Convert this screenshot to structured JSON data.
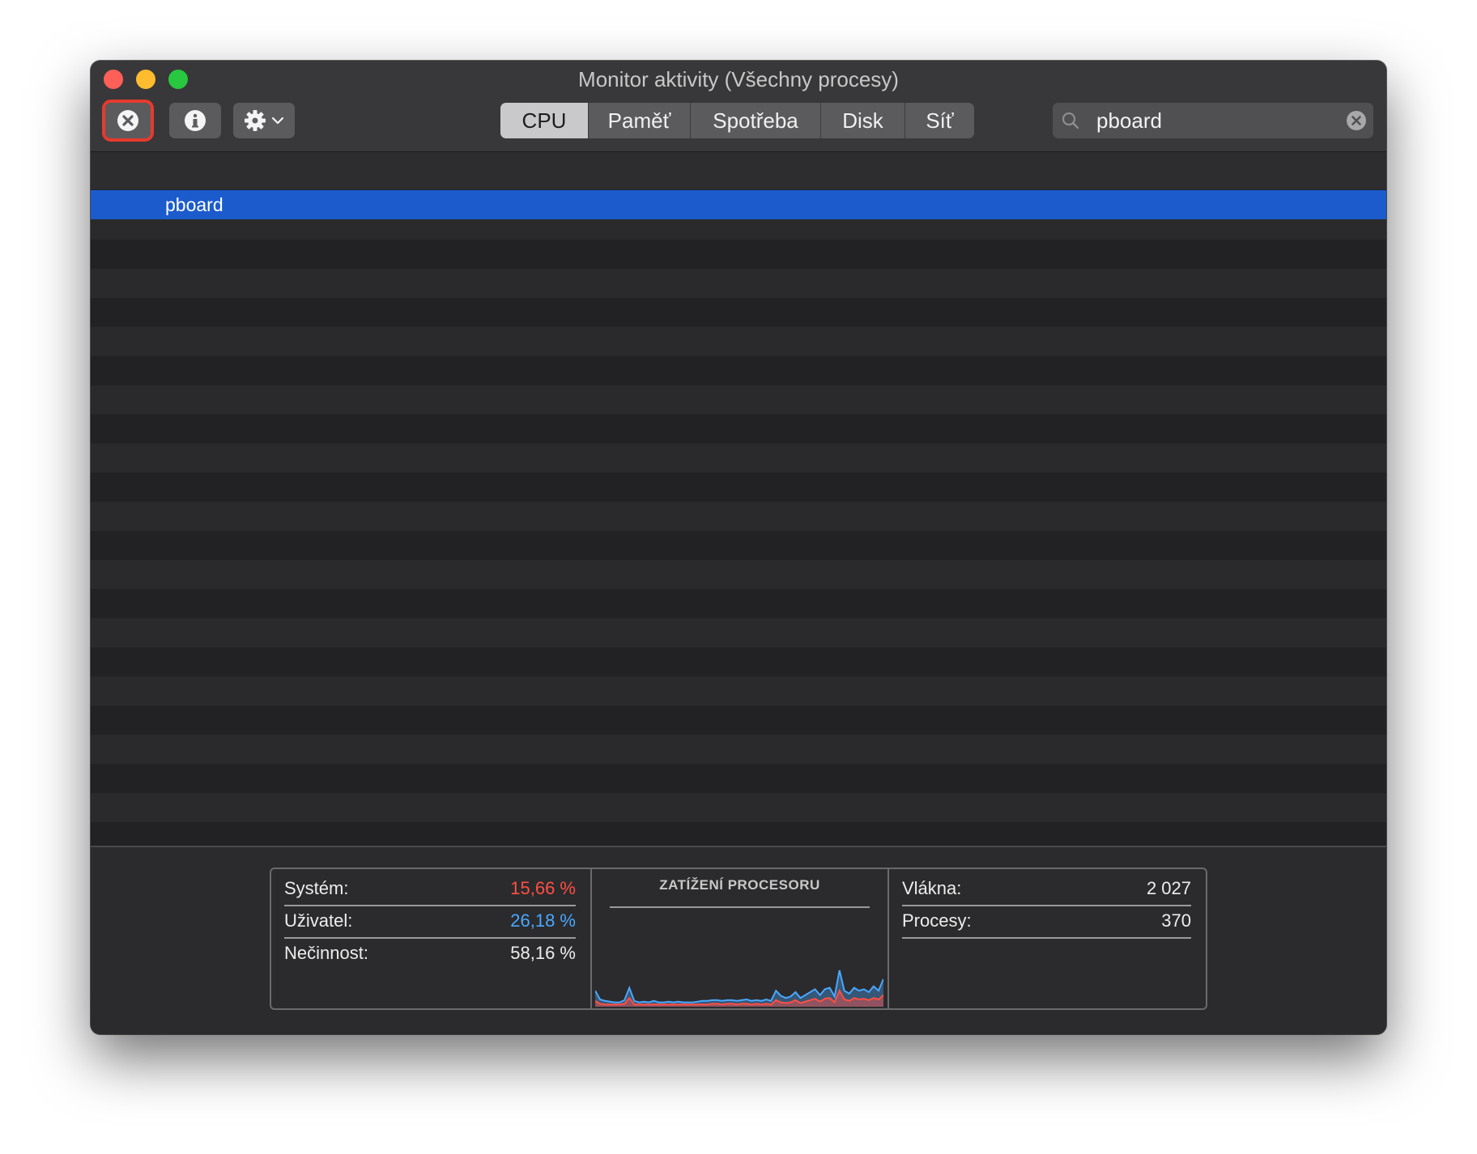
{
  "window": {
    "title": "Monitor aktivity (Všechny procesy)"
  },
  "toolbar": {
    "stop_icon": "x-circle-icon",
    "info_icon": "info-icon",
    "gear_icon": "gear-icon",
    "tabs": [
      {
        "label": "CPU",
        "active": true
      },
      {
        "label": "Paměť",
        "active": false
      },
      {
        "label": "Spotřeba",
        "active": false
      },
      {
        "label": "Disk",
        "active": false
      },
      {
        "label": "Síť",
        "active": false
      }
    ],
    "search": {
      "value": "pboard"
    }
  },
  "process_list": {
    "rows": [
      {
        "name": "pboard",
        "selected": true
      }
    ]
  },
  "stats": {
    "system_label": "Systém:",
    "system_value": "15,66 %",
    "user_label": "Uživatel:",
    "user_value": "26,18 %",
    "idle_label": "Nečinnost:",
    "idle_value": "58,16 %",
    "chart_title": "ZATÍŽENÍ PROCESORU",
    "threads_label": "Vlákna:",
    "threads_value": "2 027",
    "processes_label": "Procesy:",
    "processes_value": "370"
  },
  "chart_data": {
    "type": "area",
    "title": "ZATÍŽENÍ PROCESORU",
    "ylim": [
      0,
      100
    ],
    "series": [
      {
        "color": "#4aa8ff",
        "values": [
          22,
          10,
          8,
          7,
          6,
          6,
          9,
          26,
          8,
          6,
          7,
          6,
          8,
          6,
          6,
          7,
          6,
          7,
          6,
          6,
          6,
          7,
          8,
          8,
          9,
          9,
          8,
          9,
          9,
          8,
          9,
          10,
          8,
          9,
          8,
          10,
          8,
          22,
          15,
          12,
          14,
          20,
          12,
          16,
          20,
          24,
          16,
          24,
          26,
          14,
          50,
          22,
          18,
          26,
          22,
          24,
          20,
          28,
          22,
          38
        ]
      },
      {
        "color": "#ff4f44",
        "values": [
          8,
          4,
          3,
          3,
          3,
          3,
          4,
          12,
          3,
          3,
          3,
          3,
          3,
          3,
          3,
          3,
          3,
          3,
          3,
          3,
          3,
          3,
          3,
          3,
          4,
          4,
          3,
          4,
          4,
          3,
          4,
          4,
          3,
          4,
          3,
          4,
          3,
          9,
          6,
          5,
          6,
          9,
          5,
          7,
          9,
          11,
          7,
          11,
          12,
          6,
          22,
          10,
          8,
          12,
          10,
          11,
          9,
          12,
          10,
          16
        ]
      }
    ]
  }
}
